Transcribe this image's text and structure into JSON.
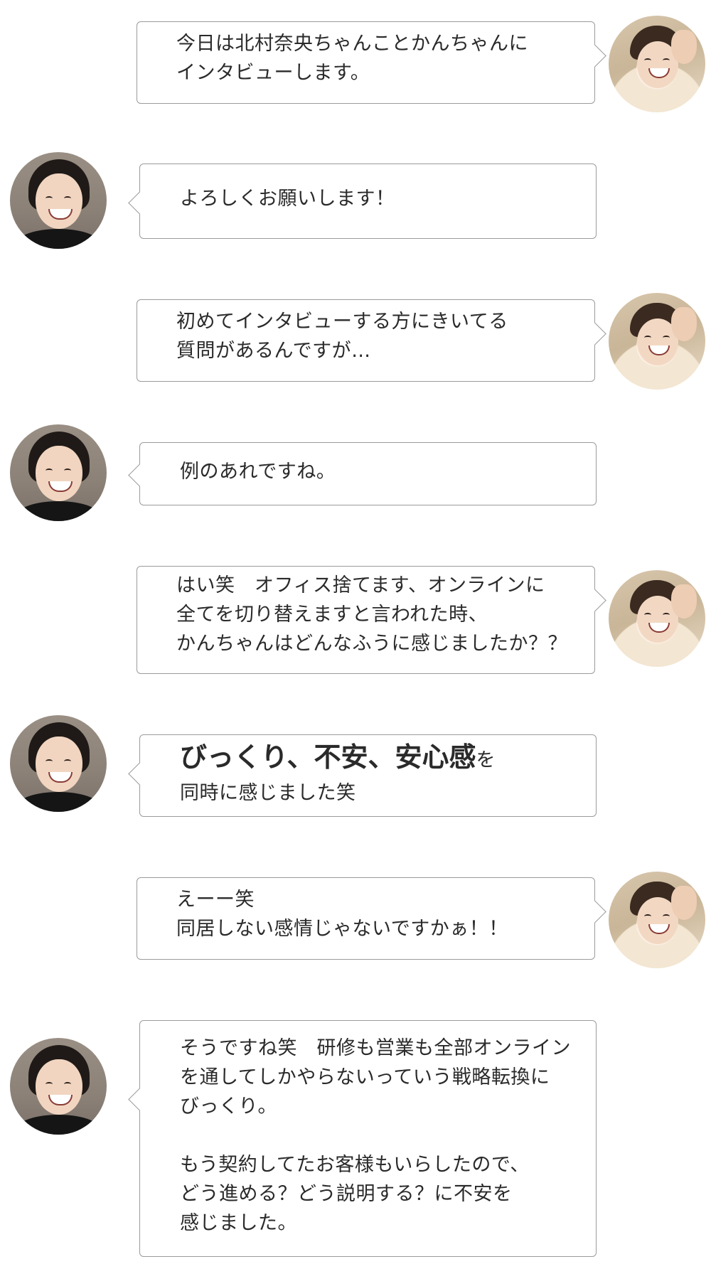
{
  "messages": [
    {
      "speaker": "interviewer",
      "lines": [
        "今日は北村奈央ちゃんことかんちゃんに",
        "インタビューします。"
      ]
    },
    {
      "speaker": "interviewee",
      "lines": [
        "よろしくお願いします！"
      ]
    },
    {
      "speaker": "interviewer",
      "lines": [
        "初めてインタビューする方にきいてる",
        "質問があるんですが…"
      ]
    },
    {
      "speaker": "interviewee",
      "lines": [
        "例のあれですね。"
      ]
    },
    {
      "speaker": "interviewer",
      "lines": [
        "はい笑　オフィス捨てます、オンラインに",
        "全てを切り替えますと言われた時、",
        "かんちゃんはどんなふうに感じましたか？？"
      ]
    },
    {
      "speaker": "interviewee",
      "emphasis": "びっくり、不安、安心感",
      "emphasis_suffix": "を",
      "lines": [
        "同時に感じました笑"
      ]
    },
    {
      "speaker": "interviewer",
      "lines": [
        "えーー笑",
        "同居しない感情じゃないですかぁ！！"
      ]
    },
    {
      "speaker": "interviewee",
      "lines": [
        "そうですね笑　研修も営業も全部オンライン",
        "を通してしかやらないっていう戦略転換に",
        "びっくり。",
        "",
        "もう契約してたお客様もいらしたので、",
        "どう進める？どう説明する？に不安を",
        "感じました。"
      ]
    }
  ],
  "colors": {
    "bubble_border": "#9b9b9b",
    "text": "#2a2a2a",
    "background": "#ffffff"
  },
  "icons": {
    "interviewer": "interviewer-avatar",
    "interviewee": "interviewee-avatar"
  }
}
